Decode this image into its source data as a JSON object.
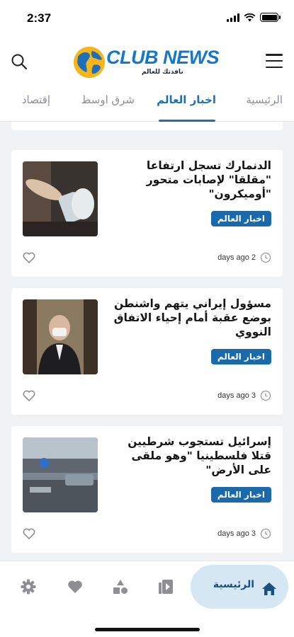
{
  "status_bar": {
    "time": "2:37"
  },
  "header": {
    "logo_title": "CLUB NEWS",
    "logo_subtitle": "نافذتك للعالم"
  },
  "tabs": [
    {
      "label": "الرئيسية",
      "active": false
    },
    {
      "label": "اخبار العالم",
      "active": true
    },
    {
      "label": "شرق اوسط",
      "active": false
    },
    {
      "label": "إقتصاد",
      "active": false
    }
  ],
  "articles": [
    {
      "title": "الدنمارك تسجل ارتفاعا \"مقلقا\" لإصابات متحور \"أوميكرون\"",
      "category": "اخبار العالم",
      "time_ago": "days ago 2"
    },
    {
      "title": "مسؤول إيراني يتهم واشنطن بوضع عقبة أمام إحياء الاتفاق النووي",
      "category": "اخبار العالم",
      "time_ago": "days ago 3"
    },
    {
      "title": "إسرائيل تستجوب شرطيين قتلا فلسطينيا \"وهو ملقى على الأرض\"",
      "category": "اخبار العالم",
      "time_ago": "days ago 3"
    }
  ],
  "bottom_nav": {
    "home_label": "الرئيسية",
    "icons": [
      "home-icon",
      "video-library-icon",
      "categories-icon",
      "favorites-icon",
      "settings-icon"
    ]
  },
  "colors": {
    "accent": "#1f6fb2",
    "badge": "#1a6aab",
    "home_pill": "#d6e7f4"
  }
}
